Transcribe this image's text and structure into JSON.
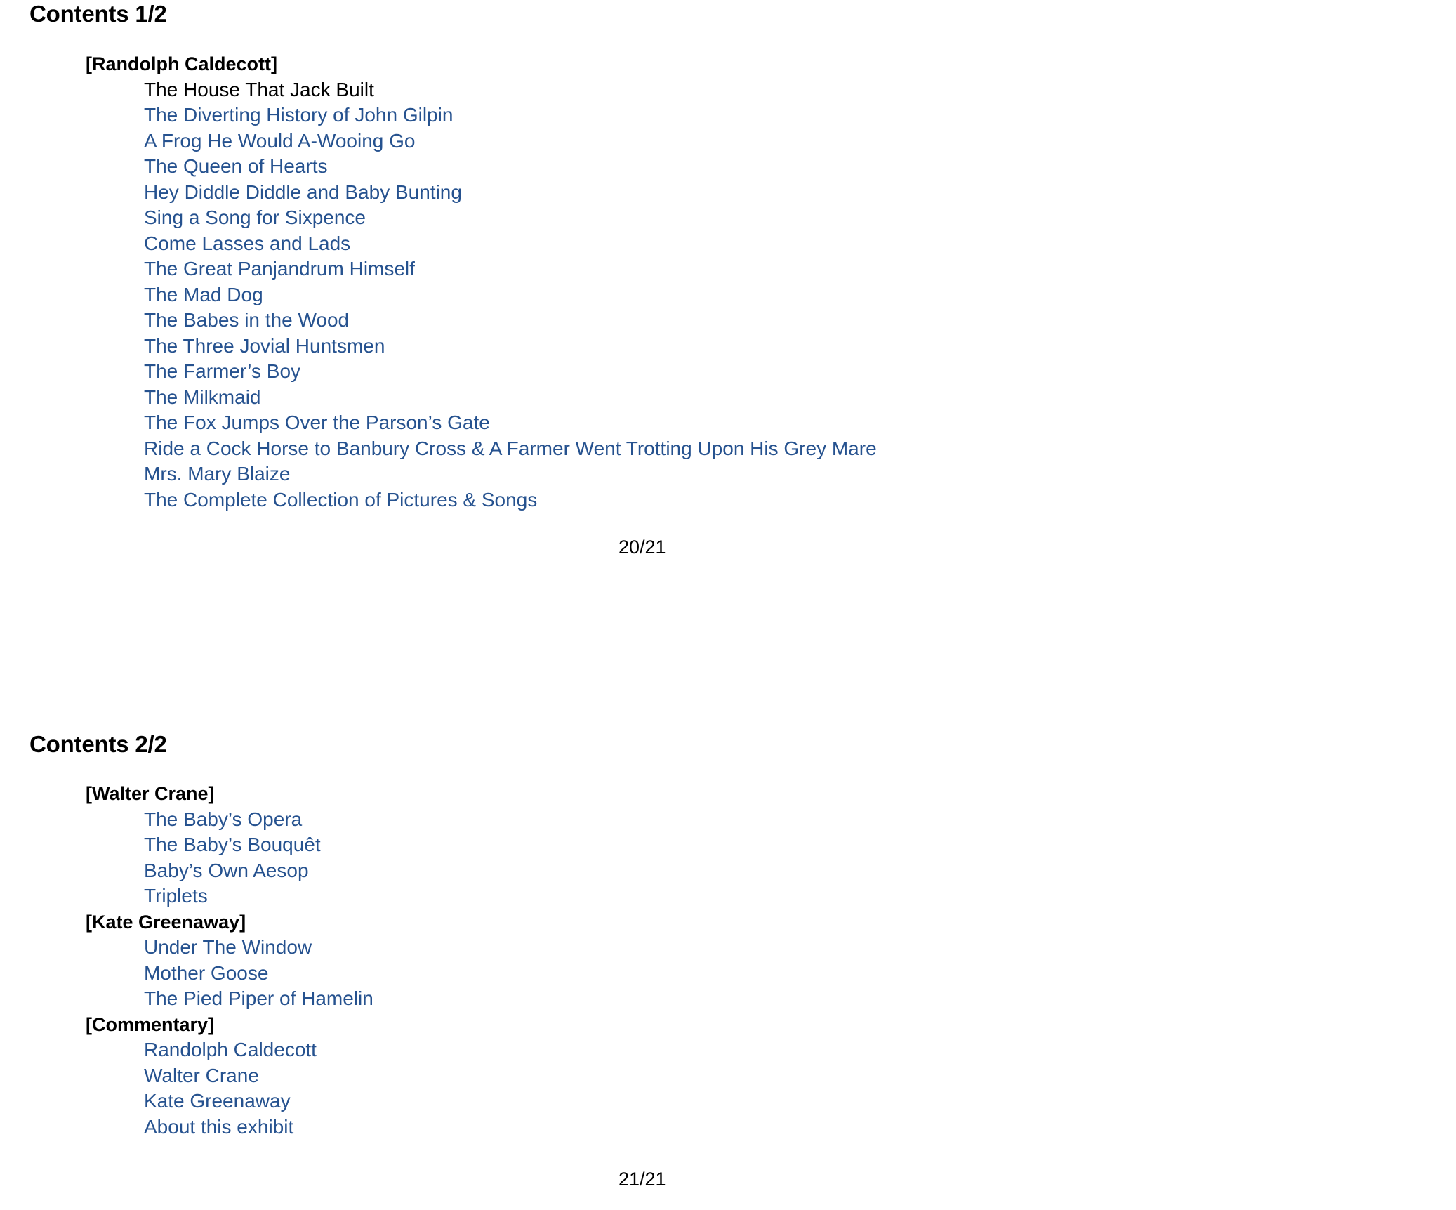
{
  "document": {
    "link_color": "#26528f",
    "text_color": "#000000",
    "background_color": "#ffffff"
  },
  "pages": [
    {
      "heading": "Contents 1/2",
      "page_number": "20/21",
      "groups": [
        {
          "label": "[Randolph Caldecott]",
          "entries": [
            {
              "text": "The House That Jack Built",
              "is_link": false
            },
            {
              "text": "The Diverting History of John Gilpin",
              "is_link": true
            },
            {
              "text": "A Frog He Would A-Wooing Go",
              "is_link": true
            },
            {
              "text": "The Queen of Hearts",
              "is_link": true
            },
            {
              "text": "Hey Diddle Diddle and Baby Bunting",
              "is_link": true
            },
            {
              "text": "Sing a Song for Sixpence",
              "is_link": true
            },
            {
              "text": "Come Lasses and Lads",
              "is_link": true
            },
            {
              "text": "The Great Panjandrum Himself",
              "is_link": true
            },
            {
              "text": "The Mad Dog",
              "is_link": true
            },
            {
              "text": "The Babes in the Wood",
              "is_link": true
            },
            {
              "text": "The Three Jovial Huntsmen",
              "is_link": true
            },
            {
              "text": "The Farmer’s Boy",
              "is_link": true
            },
            {
              "text": "The Milkmaid",
              "is_link": true
            },
            {
              "text": "The Fox Jumps Over the Parson’s Gate",
              "is_link": true
            },
            {
              "text": "Ride a Cock Horse to Banbury Cross & A Farmer Went Trotting Upon His Grey Mare",
              "is_link": true
            },
            {
              "text": "Mrs. Mary Blaize",
              "is_link": true
            },
            {
              "text": "The Complete Collection of Pictures & Songs",
              "is_link": true
            }
          ]
        }
      ]
    },
    {
      "heading": "Contents 2/2",
      "page_number": "21/21",
      "groups": [
        {
          "label": "[Walter Crane]",
          "entries": [
            {
              "text": "The Baby’s Opera",
              "is_link": true
            },
            {
              "text": "The Baby’s Bouquêt",
              "is_link": true
            },
            {
              "text": "Baby’s Own Aesop",
              "is_link": true
            },
            {
              "text": "Triplets",
              "is_link": true
            }
          ]
        },
        {
          "label": "[Kate Greenaway]",
          "entries": [
            {
              "text": "Under The Window",
              "is_link": true
            },
            {
              "text": "Mother Goose",
              "is_link": true
            },
            {
              "text": "The Pied Piper of Hamelin",
              "is_link": true
            }
          ]
        },
        {
          "label": "[Commentary]",
          "entries": [
            {
              "text": "Randolph Caldecott",
              "is_link": true
            },
            {
              "text": "Walter Crane",
              "is_link": true
            },
            {
              "text": "Kate Greenaway",
              "is_link": true
            },
            {
              "text": "About this exhibit",
              "is_link": true
            }
          ]
        }
      ]
    }
  ]
}
